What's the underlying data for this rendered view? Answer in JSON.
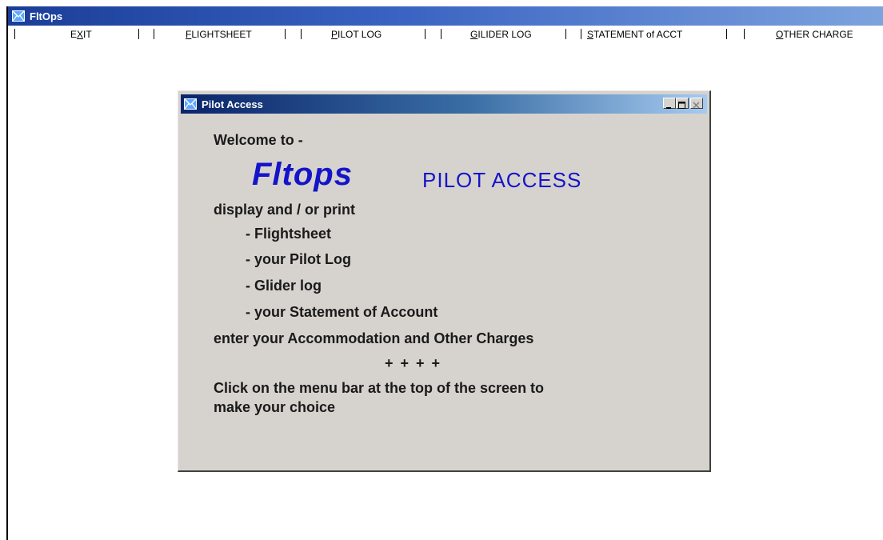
{
  "app": {
    "title": "FltOps"
  },
  "menu": {
    "items": [
      {
        "pre": "E",
        "key": "X",
        "post": "IT"
      },
      {
        "pre": "",
        "key": "F",
        "post": "LIGHTSHEET"
      },
      {
        "pre": "",
        "key": "P",
        "post": "ILOT LOG"
      },
      {
        "pre": "",
        "key": "G",
        "post": "ILIDER LOG"
      },
      {
        "pre": "",
        "key": "S",
        "post": "TATEMENT of ACCT"
      },
      {
        "pre": "",
        "key": "O",
        "post": "THER CHARGE"
      }
    ]
  },
  "dialog": {
    "title": "Pilot Access",
    "welcome": "Welcome to -",
    "brand": "Fltops",
    "brand_sub": "PILOT ACCESS",
    "intro": "display and / or print",
    "options": [
      "- Flightsheet",
      "- your Pilot Log",
      "- Glider log",
      "- your Statement of Account"
    ],
    "enter_line": "enter your Accommodation and Other Charges",
    "separator": "+ + + +",
    "instruction_line1": "Click on the menu bar at the top of the screen to",
    "instruction_line2": "make your choice"
  },
  "colors": {
    "app_titlebar": "#1a3d98",
    "dialog_titlebar": "#0a246a",
    "dialog_bg": "#d6d3ce",
    "brand": "#1414c8"
  },
  "icons": {
    "app_icon": "envelope-icon",
    "dialog_icon": "envelope-icon",
    "minimize": "minimize-icon",
    "maximize": "maximize-icon",
    "close": "close-icon"
  }
}
